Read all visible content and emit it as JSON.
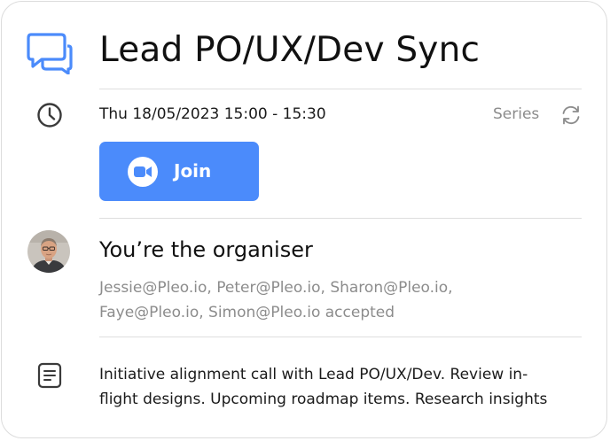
{
  "event": {
    "title": "Lead PO/UX/Dev Sync",
    "datetime": "Thu 18/05/2023 15:00 - 15:30",
    "series_label": "Series",
    "join_label": "Join",
    "organiser_text": "You’re the organiser",
    "attendees_line1": "Jessie@Pleo.io, Peter@Pleo.io, Sharon@Pleo.io,",
    "attendees_line2": "Faye@Pleo.io, Simon@Pleo.io accepted",
    "description_line1": "Initiative alignment call with Lead PO/UX/Dev. Review in-",
    "description_line2": "flight designs. Upcoming roadmap items. Research insights"
  },
  "icons": {
    "chat": "chat-bubbles-icon",
    "clock": "clock-icon",
    "repeat": "repeat-icon",
    "video": "video-camera-icon",
    "notes": "notes-icon"
  },
  "colors": {
    "accent": "#4b8bfb",
    "muted_text": "#8c8c8c",
    "icon_dark": "#3a3a3a"
  }
}
